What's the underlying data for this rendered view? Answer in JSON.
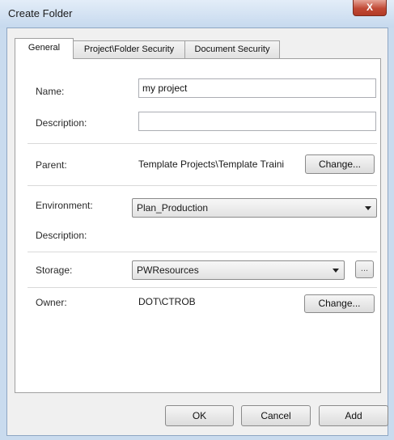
{
  "window": {
    "title": "Create Folder",
    "close_glyph": "X"
  },
  "tabs": [
    {
      "label": "General"
    },
    {
      "label": "Project\\Folder Security"
    },
    {
      "label": "Document Security"
    }
  ],
  "form": {
    "name_label": "Name:",
    "name_value": "my project",
    "description_label": "Description:",
    "description_value": "",
    "parent_label": "Parent:",
    "parent_value": "Template Projects\\Template Traini",
    "parent_change_label": "Change...",
    "environment_label": "Environment:",
    "environment_value": "Plan_Production",
    "env_description_label": "Description:",
    "storage_label": "Storage:",
    "storage_value": "PWResources",
    "storage_browse_label": "...",
    "owner_label": "Owner:",
    "owner_value": "DOT\\CTROB",
    "owner_change_label": "Change..."
  },
  "footer": {
    "ok_label": "OK",
    "cancel_label": "Cancel",
    "add_label": "Add"
  },
  "colors": {
    "titlebar": "#c6d9ee",
    "close_button": "#c14a36",
    "dialog_bg": "#f0f0f0"
  }
}
